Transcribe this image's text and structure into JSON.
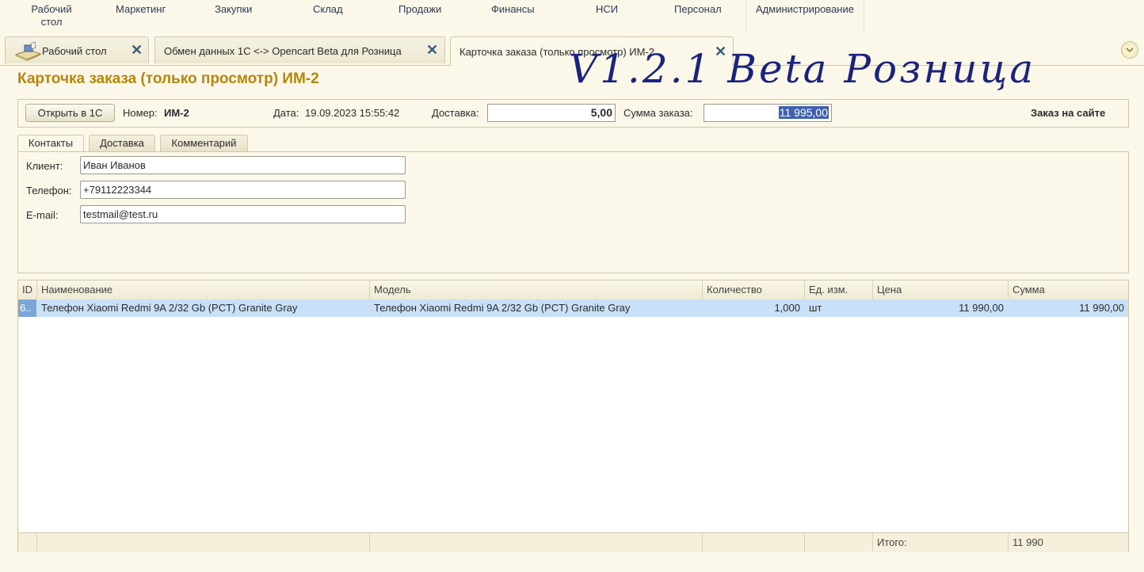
{
  "menu": {
    "items": [
      {
        "label": "Рабочий\nстол"
      },
      {
        "label": "Маркетинг"
      },
      {
        "label": "Закупки"
      },
      {
        "label": "Склад"
      },
      {
        "label": "Продажи"
      },
      {
        "label": "Финансы"
      },
      {
        "label": "НСИ"
      },
      {
        "label": "Персонал"
      },
      {
        "label": "Администрирование"
      }
    ]
  },
  "tabs": [
    {
      "label": "Рабочий стол",
      "icon": "desktop-icon"
    },
    {
      "label": "Обмен данных 1С <-> Opencart Beta для Розница"
    },
    {
      "label": "Карточка заказа (только просмотр) ИМ-2",
      "active": true
    }
  ],
  "page": {
    "title": "Карточка заказа (только просмотр) ИМ-2",
    "watermark": "V1.2.1 Beta Розница"
  },
  "header": {
    "open_button": "Открыть в 1С",
    "number_label": "Номер:",
    "number_value": "ИМ-2",
    "date_label": "Дата:",
    "date_value": "19.09.2023 15:55:42",
    "delivery_label": "Доставка:",
    "delivery_value": "5,00",
    "sum_label": "Сумма заказа:",
    "sum_value": "11 995,00",
    "site_order": "Заказ на сайте"
  },
  "inner_tabs": [
    {
      "label": "Контакты",
      "active": true
    },
    {
      "label": "Доставка"
    },
    {
      "label": "Комментарий"
    }
  ],
  "contacts": {
    "client_label": "Клиент:",
    "client_value": "Иван Иванов",
    "phone_label": "Телефон:",
    "phone_value": "+79112223344",
    "email_label": "E-mail:",
    "email_value": "testmail@test.ru"
  },
  "table": {
    "columns": [
      "ID",
      "Наименование",
      "Модель",
      "Количество",
      "Ед. изм.",
      "Цена",
      "Сумма"
    ],
    "rows": [
      {
        "id": "6..",
        "name": "Телефон Xiaomi Redmi 9A 2/32 Gb (PCT) Granite Gray",
        "model": "Телефон Xiaomi Redmi 9A 2/32 Gb (PCT) Granite Gray",
        "qty": "1,000",
        "unit": "шт",
        "price": "11 990,00",
        "sum": "11 990,00"
      }
    ],
    "footer": {
      "total_label": "Итого:",
      "total_value": "11 990"
    }
  },
  "colors": {
    "title": "#b8860b",
    "watermark": "#1a237e",
    "selection": "#c8e1f8"
  }
}
